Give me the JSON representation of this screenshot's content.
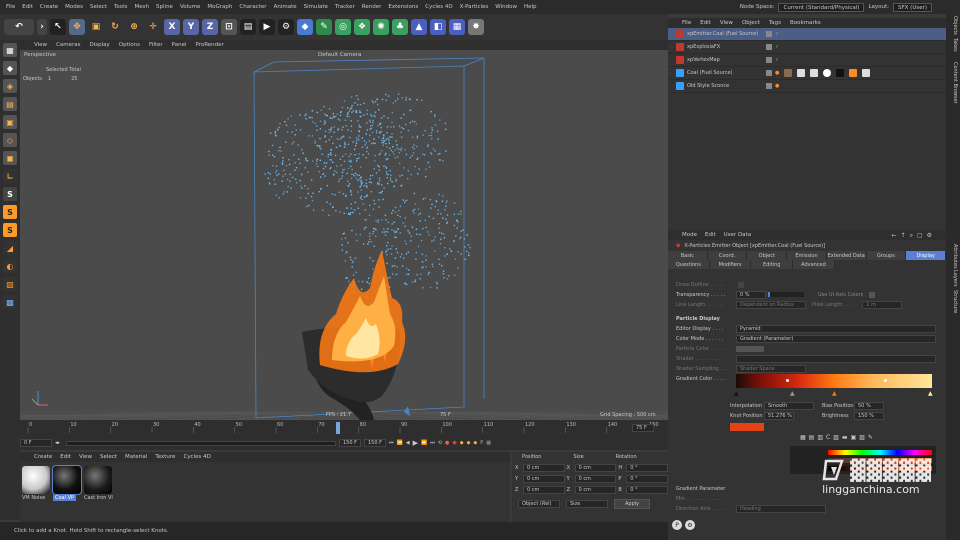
{
  "menu": [
    "File",
    "Edit",
    "Create",
    "Modes",
    "Select",
    "Tools",
    "Mesh",
    "Spline",
    "Volume",
    "MoGraph",
    "Character",
    "Animate",
    "Simulate",
    "Tracker",
    "Render",
    "Extensions",
    "Cycles 4D",
    "X-Particles",
    "Window",
    "Help"
  ],
  "node_space": {
    "label": "Node Space:",
    "value": "Current (Standard/Physical)"
  },
  "layout": {
    "label": "Layout:",
    "value": "SFX (User)"
  },
  "toolbar_axes": [
    "X",
    "Y",
    "Z"
  ],
  "viewport_menu": [
    "View",
    "Cameras",
    "Display",
    "Options",
    "Filter",
    "Panel",
    "ProRender"
  ],
  "viewport": {
    "mode": "Perspective",
    "camera": "Default Camera",
    "selected_total": "Selected Total",
    "objects_label": "Objects",
    "objects_count": "1",
    "objects_total": "25",
    "fps": "FPS : 21.7",
    "frame": "75 F",
    "grid_spacing": "Grid Spacing : 500 cm"
  },
  "timeline": {
    "ticks": [
      "0",
      "10",
      "20",
      "30",
      "40",
      "50",
      "60",
      "70",
      "80",
      "90",
      "100",
      "110",
      "120",
      "130",
      "140",
      "150"
    ],
    "current": "75 F",
    "start": "0 F",
    "start2": "0 F",
    "end": "150 F",
    "end2": "150 F"
  },
  "material_menu": [
    "Create",
    "Edit",
    "View",
    "Select",
    "Material",
    "Texture",
    "Cycles 4D"
  ],
  "materials": [
    {
      "name": "VM Noise",
      "color": "#c8c8c8"
    },
    {
      "name": "Coal VP",
      "color": "#111111"
    },
    {
      "name": "Cast Iron VI",
      "color": "#1d1d1d"
    }
  ],
  "coords": {
    "headers": [
      "Position",
      "Size",
      "Rotation"
    ],
    "rows": [
      {
        "axis": "X",
        "pos": "0 cm",
        "size": "0 cm",
        "rlabel": "H",
        "rot": "0 °"
      },
      {
        "axis": "Y",
        "pos": "0 cm",
        "size": "0 cm",
        "rlabel": "P",
        "rot": "0 °"
      },
      {
        "axis": "Z",
        "pos": "0 cm",
        "size": "0 cm",
        "rlabel": "B",
        "rot": "0 °"
      }
    ],
    "mode": "Object (Rel)",
    "size_mode": "Size",
    "apply": "Apply"
  },
  "status": "Click to add a Knot. Hold Shift to rectangle-select Knots.",
  "object_menu": [
    "File",
    "Edit",
    "View",
    "Object",
    "Tags",
    "Bookmarks"
  ],
  "objects": [
    {
      "name": "xpEmitter.Coal (Fuel Source)",
      "color": "#c0392b",
      "selected": true
    },
    {
      "name": "xpExplosiaFX",
      "color": "#c0392b",
      "selected": false
    },
    {
      "name": "xpVertexMap",
      "color": "#c0392b",
      "selected": false
    },
    {
      "name": "Coal (Fuel Source)",
      "color": "#3aa0ff",
      "selected": false
    },
    {
      "name": "Old Style Sconce",
      "color": "#3aa0ff",
      "selected": false
    }
  ],
  "attr": {
    "menu": [
      "Mode",
      "Edit",
      "User Data"
    ],
    "title": "X-Particles Emitter Object [xpEmitter.Coal (Fuel Source)]",
    "tabs1": [
      "Basic",
      "Coord.",
      "Object",
      "Emission",
      "Extended Data",
      "Groups",
      "Display"
    ],
    "tabs2": [
      "Questions",
      "Modifiers",
      "Editing",
      "Advanced"
    ],
    "draw_outline": "Draw Outline . . . . .",
    "transparency": "Transparency . . . . .",
    "transparency_val": "0 %",
    "use_ui": "Use UI Axis Colors",
    "line_length": "Line Length . . . . . .",
    "line_length_val": "Dependent on Radius",
    "pixel_length": "Pixel Length . . . . .",
    "pixel_length_val": "1 m",
    "section": "Particle Display",
    "editor_display": "Editor Display . . . .",
    "editor_display_val": "Pyramid",
    "color_mode": "Color Mode . . . . . .",
    "color_mode_val": "Gradient (Parameter)",
    "particle_color": "Particle Color . . . . .",
    "shader": "Shader . . . . . . . . .",
    "shader_sampling": "Shader Sampling . . .",
    "shader_sampling_val": "Shader Space",
    "gradient_color": "Gradient Color . . . .",
    "interpolation": "Interpolation",
    "interpolation_val": "Smooth",
    "bias_position": "Bias Position",
    "bias_val": "50 %",
    "knot_position": "Knot Position",
    "knot_val": "51.276 %",
    "brightness": "Brightness",
    "brightness_val": "150 %",
    "gradient_param": "Gradient Parameter",
    "min": "Min . . . . . . . . . . .",
    "direction_axis": "Direction Axis . . . . .",
    "direction_axis_val": "Heading"
  },
  "side_tabs": [
    "Objects",
    "Takes",
    "Content Browser",
    "Attributes",
    "Layers",
    "Structure"
  ],
  "watermark": "lingganchina.com",
  "colors": {
    "accent": "#5b7fd1",
    "particle": "#6fc3ff",
    "fire": "#ff8a1f"
  }
}
